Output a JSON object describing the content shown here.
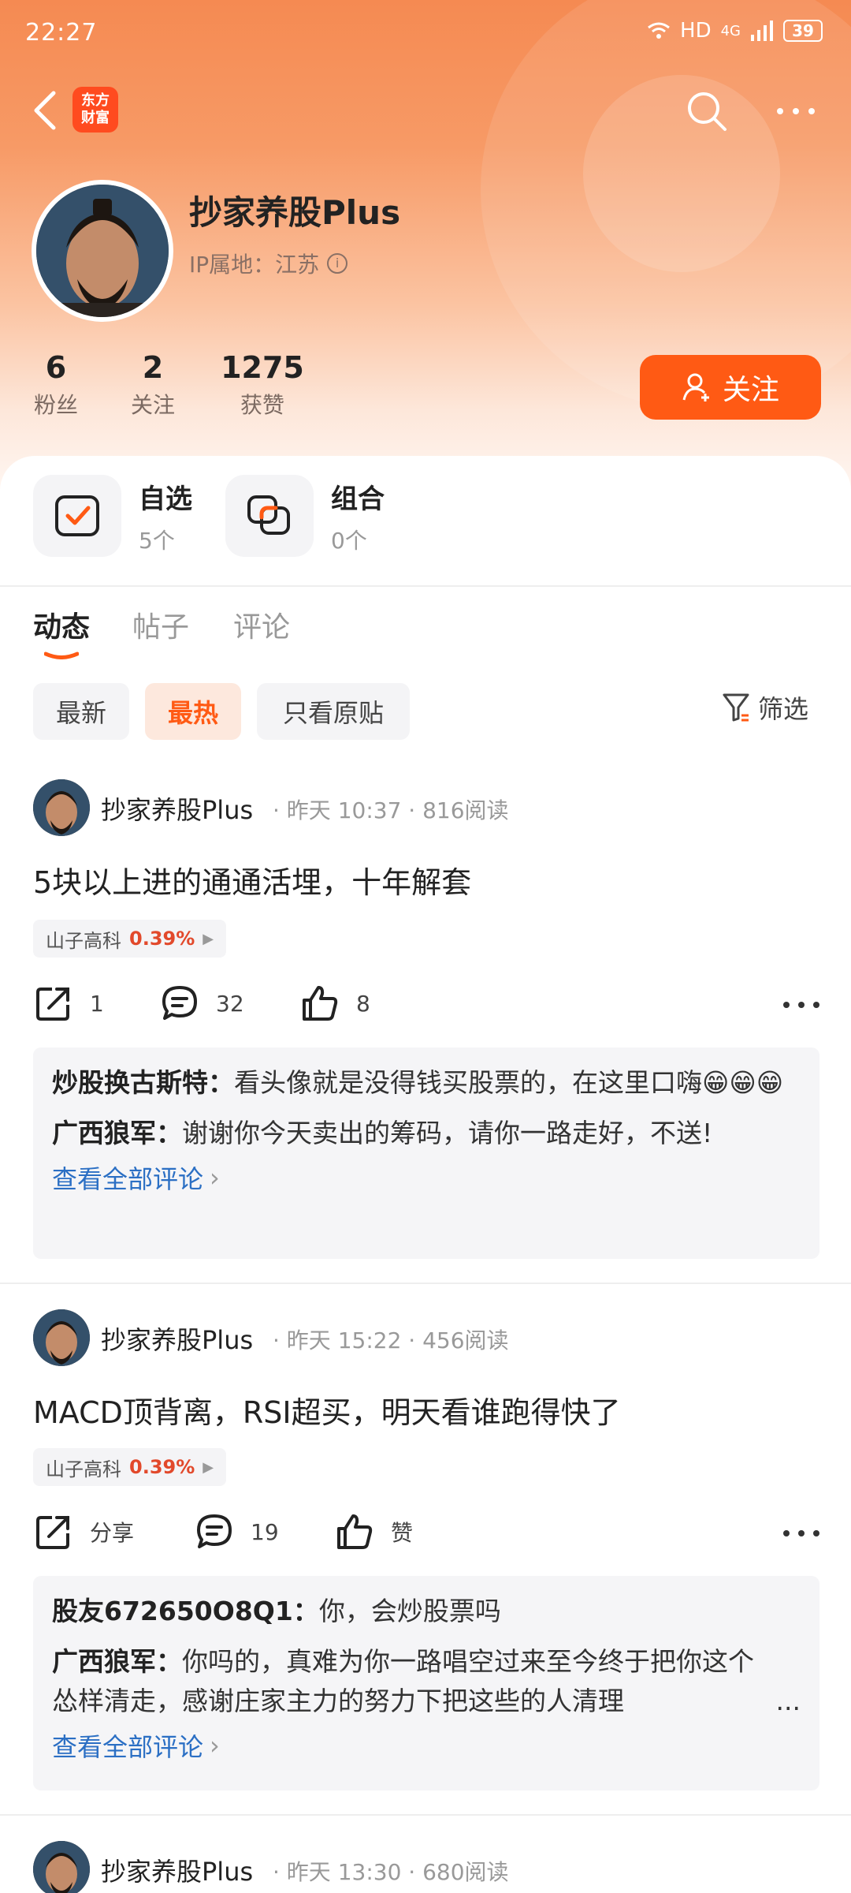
{
  "status_bar": {
    "time": "22:27",
    "network": "HD",
    "signal": "4G",
    "battery": "39"
  },
  "nav": {
    "logo_line1": "东方",
    "logo_line2": "财富"
  },
  "profile": {
    "name": "抄家养股Plus",
    "ip_location": "IP属地：江苏",
    "stats": [
      {
        "value": "6",
        "label": "粉丝"
      },
      {
        "value": "2",
        "label": "关注"
      },
      {
        "value": "1275",
        "label": "获赞"
      }
    ],
    "follow_label": "关注"
  },
  "portfolio": [
    {
      "title": "自选",
      "count": "5个"
    },
    {
      "title": "组合",
      "count": "0个"
    }
  ],
  "tabs": [
    "动态",
    "帖子",
    "评论"
  ],
  "filters": [
    "最新",
    "最热",
    "只看原贴"
  ],
  "filter_label": "筛选",
  "accent_color": "#ff5a14",
  "posts": [
    {
      "author": "抄家养股Plus",
      "meta": "· 昨天 10:37 · 816阅读",
      "content": "5块以上进的通通活埋，十年解套",
      "stock_name": "山子高科",
      "stock_change": "0.39%",
      "share": "1",
      "comments": "32",
      "likes": "8",
      "comment_list": [
        {
          "user": "炒股换古斯特：",
          "text": "看头像就是没得钱买股票的，在这里口嗨😁😁😁"
        },
        {
          "user": "广西狼军：",
          "text": "谢谢你今天卖出的筹码，请你一路走好，不送!"
        }
      ],
      "view_all": "查看全部评论"
    },
    {
      "author": "抄家养股Plus",
      "meta": "· 昨天 15:22 · 456阅读",
      "content": "MACD顶背离，RSI超买，明天看谁跑得快了",
      "stock_name": "山子高科",
      "stock_change": "0.39%",
      "share": "分享",
      "comments": "19",
      "likes": "赞",
      "comment_list": [
        {
          "user": "股友672650O8Q1：",
          "text": "你，会炒股票吗"
        },
        {
          "user": "广西狼军：",
          "text": "你吗的，真难为你一路唱空过来至今终于把你这个怂样清走，感谢庄家主力的努力下把这些的人清理"
        }
      ],
      "view_all": "查看全部评论"
    },
    {
      "author": "抄家养股Plus",
      "meta": "· 昨天 13:30 · 680阅读"
    }
  ]
}
